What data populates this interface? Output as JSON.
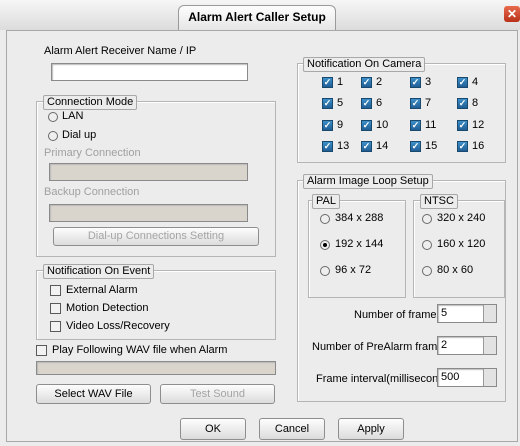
{
  "window": {
    "title": "Alarm Alert Caller Setup",
    "close_glyph": "✕"
  },
  "receiver": {
    "label": "Alarm Alert Receiver Name / IP",
    "value": ""
  },
  "connection_mode": {
    "legend": "Connection Mode",
    "lan_label": "LAN",
    "dialup_label": "Dial up",
    "primary_label": "Primary Connection",
    "primary_value": "",
    "backup_label": "Backup Connection",
    "backup_value": "",
    "settings_button": "Dial-up Connections Setting"
  },
  "notification_event": {
    "legend": "Notification On Event",
    "external_alarm": "External Alarm",
    "motion_detection": "Motion Detection",
    "video_loss": "Video Loss/Recovery"
  },
  "wav": {
    "play_label": "Play Following WAV file when Alarm",
    "path_value": "",
    "select_button": "Select WAV File",
    "test_button": "Test Sound"
  },
  "notification_camera": {
    "legend": "Notification On Camera",
    "cameras": [
      "1",
      "2",
      "3",
      "4",
      "5",
      "6",
      "7",
      "8",
      "9",
      "10",
      "11",
      "12",
      "13",
      "14",
      "15",
      "16"
    ],
    "check_glyph": "✓"
  },
  "image_loop": {
    "legend": "Alarm Image Loop Setup",
    "pal_legend": "PAL",
    "pal_options": [
      "384 x 288",
      "192 x 144",
      "96 x 72"
    ],
    "ntsc_legend": "NTSC",
    "ntsc_options": [
      "320 x 240",
      "160 x 120",
      "80 x 60"
    ],
    "frames_label": "Number of frames:",
    "frames_value": "5",
    "prealarm_label": "Number of PreAlarm frames:",
    "prealarm_value": "2",
    "interval_label": "Frame interval(millisecond):",
    "interval_value": "500"
  },
  "footer": {
    "ok": "OK",
    "cancel": "Cancel",
    "apply": "Apply"
  }
}
